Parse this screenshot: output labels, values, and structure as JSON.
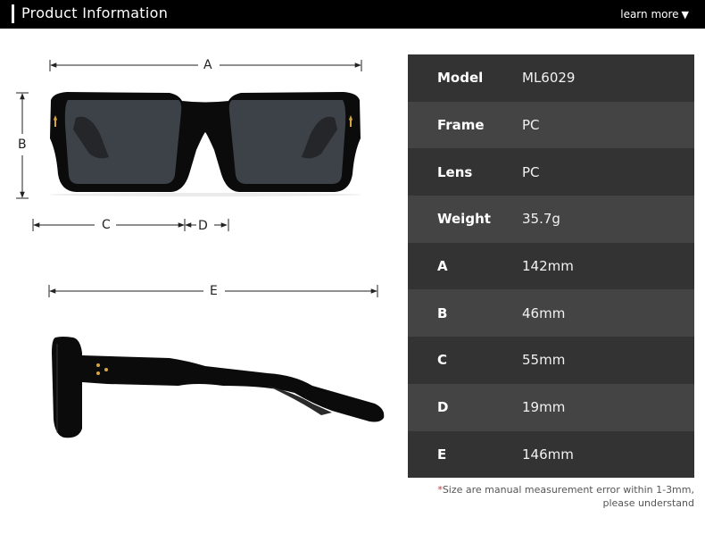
{
  "header": {
    "title": "Product Information",
    "learn_more": "learn more",
    "learn_more_icon": "triangle-down-icon"
  },
  "dimension_labels": {
    "a": "A",
    "b": "B",
    "c": "C",
    "d": "D",
    "e": "E"
  },
  "specs": [
    {
      "label": "Model",
      "value": "ML6029"
    },
    {
      "label": "Frame",
      "value": "PC"
    },
    {
      "label": "Lens",
      "value": "PC"
    },
    {
      "label": "Weight",
      "value": "35.7g"
    },
    {
      "label": "A",
      "value": "142mm"
    },
    {
      "label": "B",
      "value": "46mm"
    },
    {
      "label": "C",
      "value": "55mm"
    },
    {
      "label": "D",
      "value": "19mm"
    },
    {
      "label": "E",
      "value": "146mm"
    }
  ],
  "note": {
    "star": "*",
    "line1": "Size are manual measurement error within 1-3mm,",
    "line2": "please understand"
  },
  "colors": {
    "header_bg": "#000000",
    "row_dark": "#333333",
    "row_light": "#444444",
    "frame": "#0a0a0a",
    "lens": "#3a4046",
    "accent_gold": "#d4a640",
    "note_star": "#dd3333"
  }
}
